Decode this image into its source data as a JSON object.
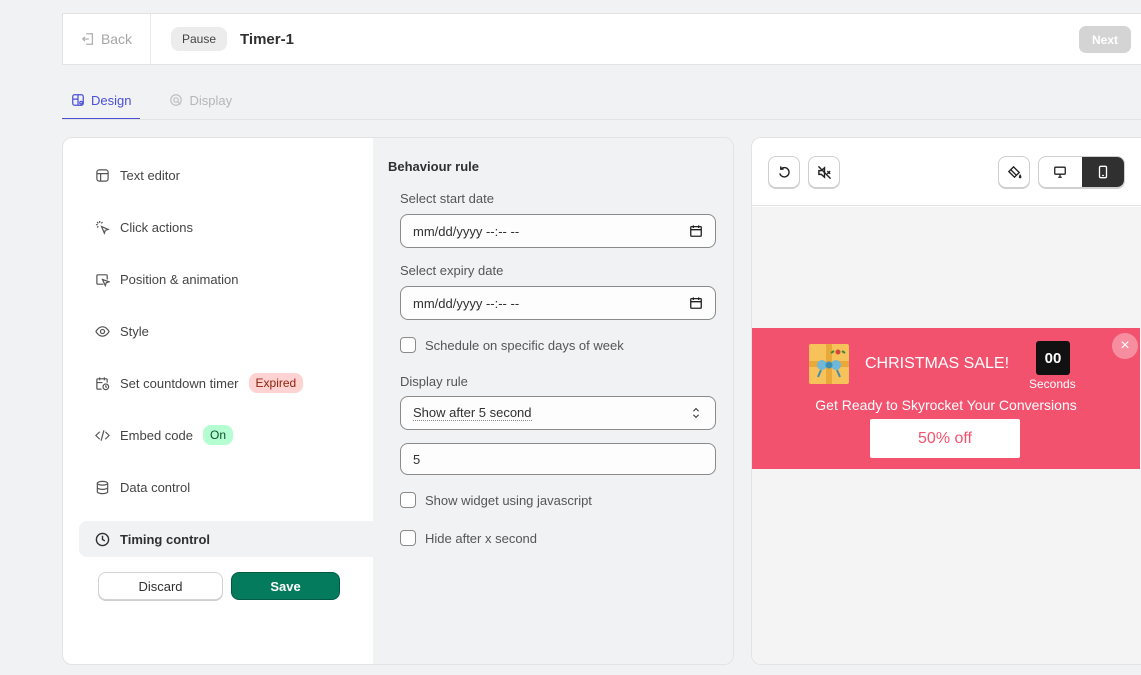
{
  "topbar": {
    "back_label": "Back",
    "status_badge": "Pause",
    "title": "Timer-1",
    "next_label": "Next"
  },
  "tabs": [
    {
      "label": "Design",
      "active": true,
      "icon": "design-icon"
    },
    {
      "label": "Display",
      "active": false,
      "icon": "display-icon"
    }
  ],
  "sidebar": {
    "items": [
      {
        "label": "Text editor",
        "icon": "text-editor-icon"
      },
      {
        "label": "Click actions",
        "icon": "click-icon"
      },
      {
        "label": "Position & animation",
        "icon": "cursor-icon"
      },
      {
        "label": "Style",
        "icon": "eye-icon"
      },
      {
        "label": "Set countdown timer",
        "icon": "calendar-clock-icon",
        "badge": "Expired"
      },
      {
        "label": "Embed code",
        "icon": "code-icon",
        "badge": "On"
      },
      {
        "label": "Data control",
        "icon": "database-icon"
      },
      {
        "label": "Timing control",
        "icon": "clock-icon",
        "active": true
      }
    ],
    "discard_label": "Discard",
    "save_label": "Save"
  },
  "settings": {
    "heading": "Behaviour rule",
    "start_date_label": "Select start date",
    "start_date_value": "mm/dd/yyyy --:-- --",
    "expiry_date_label": "Select expiry date",
    "expiry_date_value": "mm/dd/yyyy --:-- --",
    "schedule_days_label": "Schedule on specific days of week",
    "display_rule_label": "Display rule",
    "display_rule_value": "Show after 5 second",
    "seconds_value": "5",
    "show_js_label": "Show widget using javascript",
    "hide_after_label": "Hide after x second"
  },
  "preview": {
    "banner": {
      "title": "CHRISTMAS SALE!",
      "countdown_value": "00",
      "countdown_unit": "Seconds",
      "subtitle": "Get Ready to Skyrocket Your Conversions",
      "button_label": "50% off",
      "close_symbol": "×",
      "background_color": "#f2526e"
    }
  },
  "colors": {
    "accent": "#4a4fd6",
    "save_green": "#047b5d",
    "expired_bg": "#fed3d1",
    "on_bg": "#b4fed2"
  }
}
